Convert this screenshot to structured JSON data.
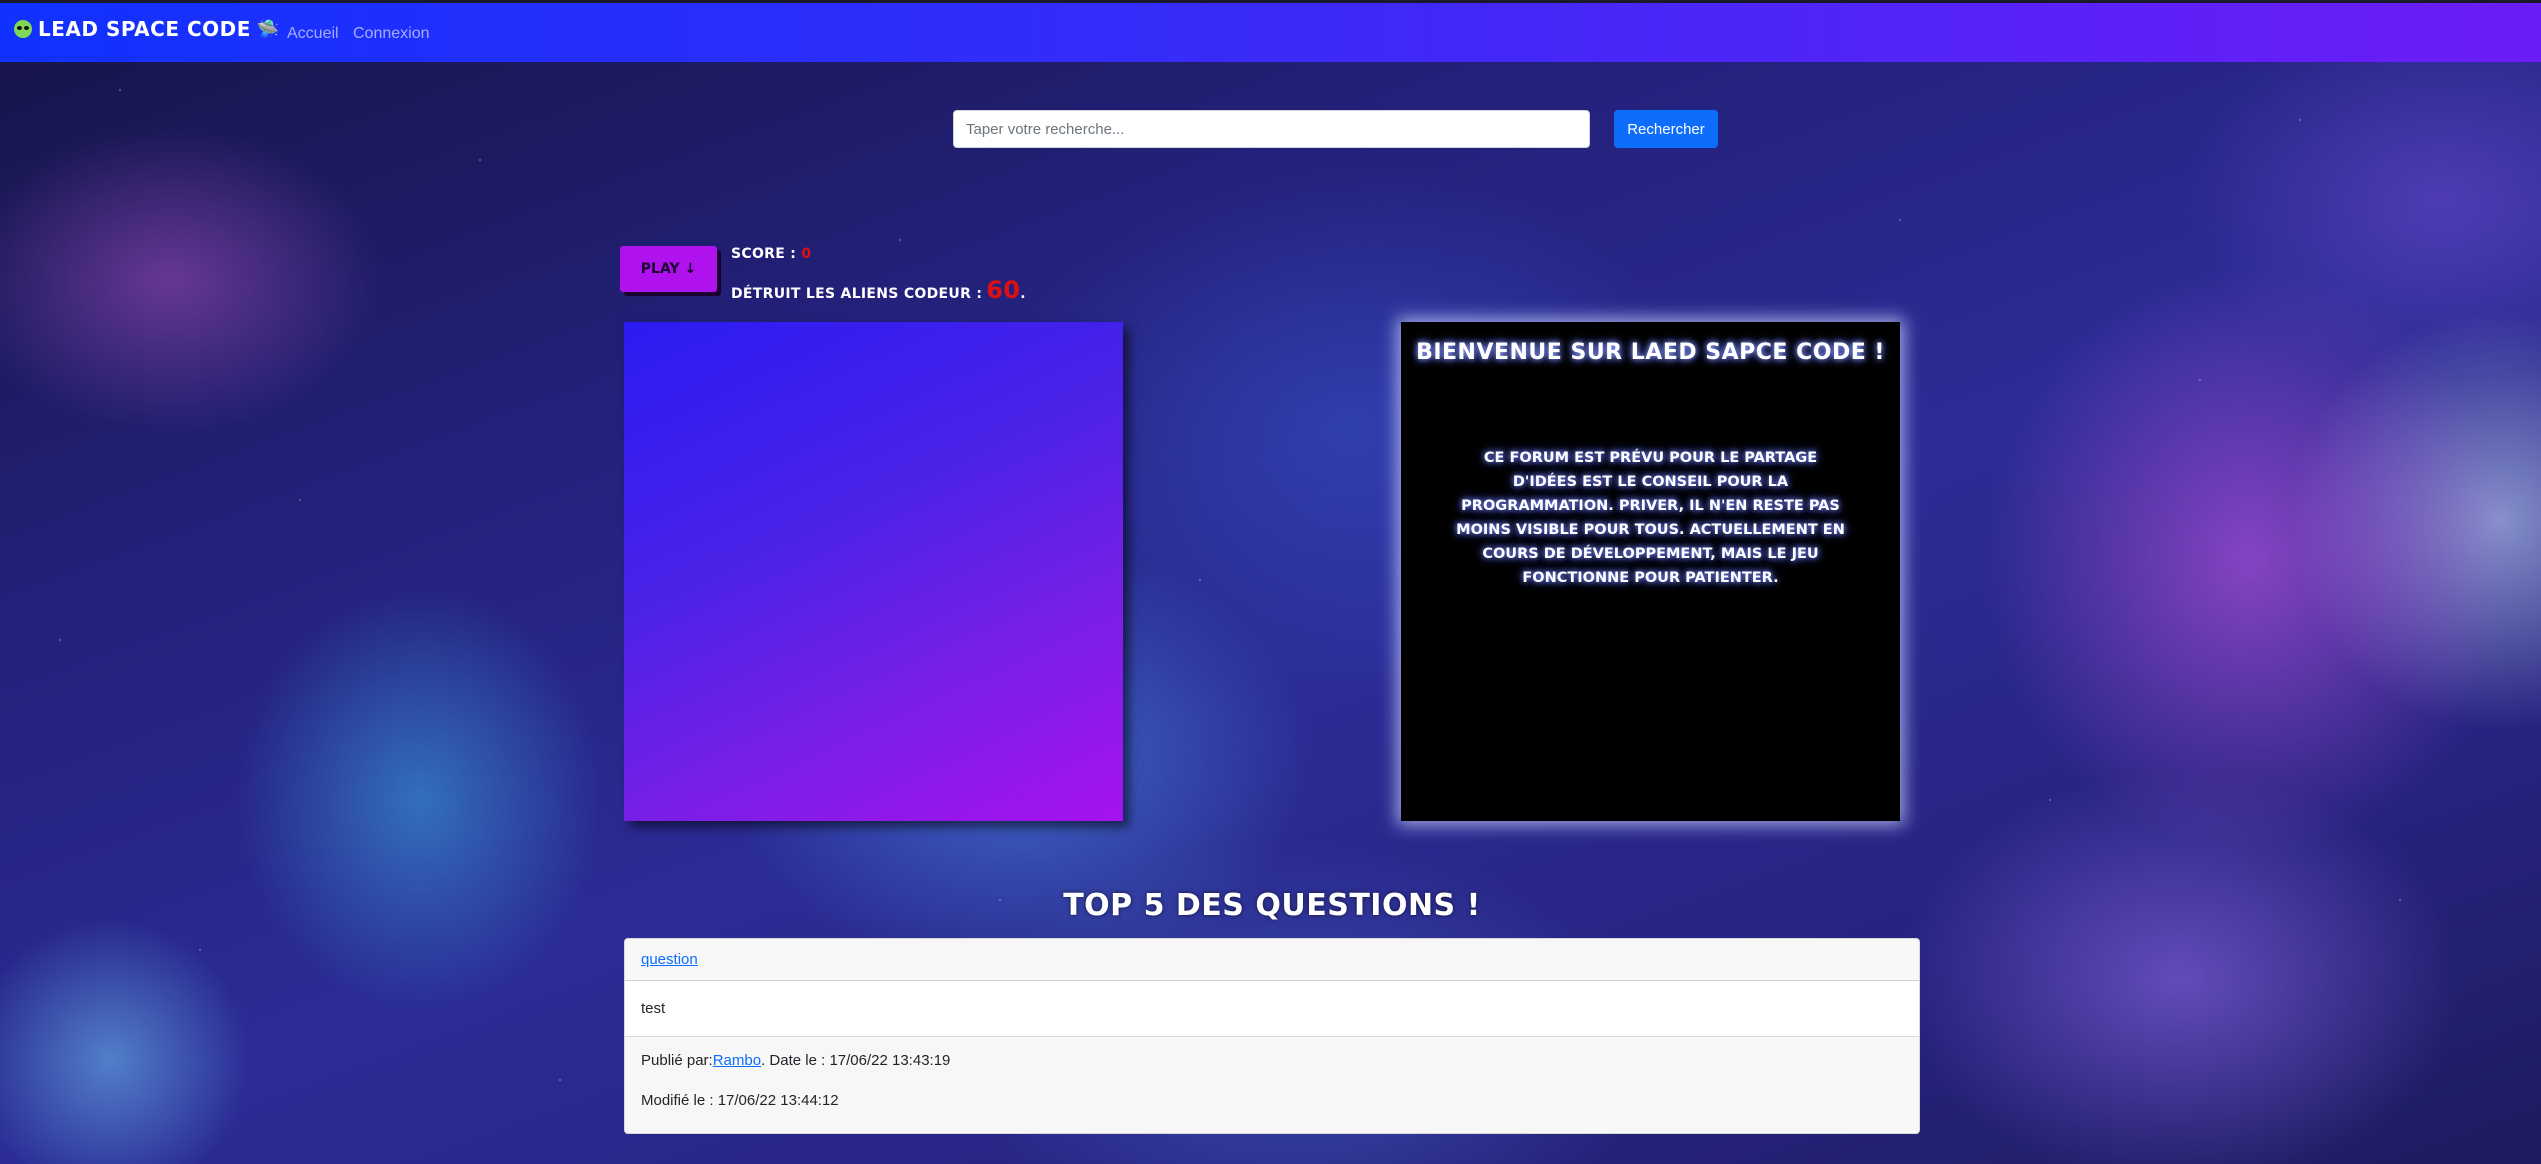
{
  "navbar": {
    "brand": "Lead Space Code",
    "links": [
      "Accueil",
      "Connexion"
    ]
  },
  "search": {
    "placeholder": "Taper votre recherche...",
    "button_label": "Rechercher"
  },
  "game": {
    "play_label": "Play ↓",
    "score_label": "Score :",
    "score_value": "0",
    "goal_label": "Détruit les aliens codeur :",
    "goal_value": "60",
    "goal_suffix": "."
  },
  "welcome": {
    "title": "Bienvenue sur Laed Sapce Code !",
    "text": "Ce forum est prévu pour le partage d'idées est le conseil pour la programmation. Priver, il n'en reste pas moins visible pour tous. Actuellement en cours de développement, mais le jeu fonctionne pour patienter."
  },
  "top_questions": {
    "title": "Top 5 des questions !",
    "items": [
      {
        "title": "question",
        "body": "test",
        "published_label": "Publié par:",
        "author": "Rambo",
        "date_text": ". Date le : 17/06/22 13:43:19",
        "modified_text": "Modifié le : 17/06/22 13:44:12"
      }
    ]
  },
  "icons": {
    "brand_left": "alien-icon",
    "brand_right": "ufo-icon"
  },
  "colors": {
    "navbar_start": "#1131ff",
    "navbar_end": "#6c1cf5",
    "accent_button": "#0d6efd",
    "play_button": "#b012ee",
    "score_red": "#e01010"
  }
}
